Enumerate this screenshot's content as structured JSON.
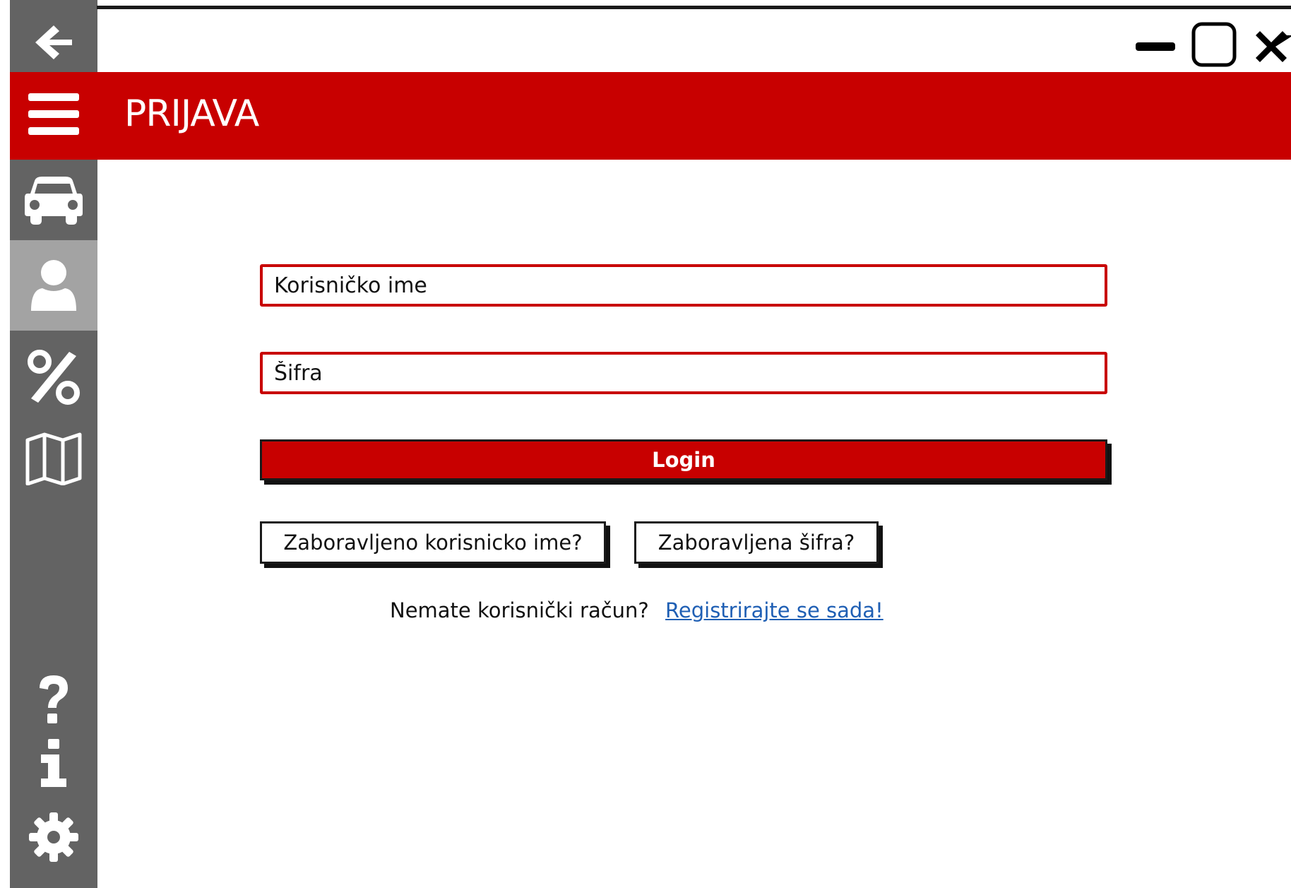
{
  "window": {
    "title": "PRIJAVA",
    "controls": [
      "minimize-icon",
      "maximize-icon",
      "close-icon"
    ]
  },
  "sidebar": {
    "items": [
      {
        "name": "back",
        "icon": "arrow-left-icon"
      },
      {
        "name": "menu",
        "icon": "hamburger-icon"
      },
      {
        "name": "vehicles",
        "icon": "car-icon"
      },
      {
        "name": "user",
        "icon": "user-icon",
        "active": true
      },
      {
        "name": "discounts",
        "icon": "percent-icon"
      },
      {
        "name": "map",
        "icon": "map-icon"
      },
      {
        "name": "help",
        "icon": "question-icon"
      },
      {
        "name": "info",
        "icon": "info-icon"
      },
      {
        "name": "settings",
        "icon": "gear-icon"
      }
    ]
  },
  "form": {
    "username_placeholder": "Korisničko ime",
    "password_placeholder": "Šifra",
    "login_label": "Login",
    "forgot_username_label": "Zaboravljeno korisnicko ime?",
    "forgot_password_label": "Zaboravljena šifra?",
    "no_account_text": "Nemate korisnički račun?",
    "register_link_text": "Registrirajte se sada!"
  },
  "colors": {
    "accent": "#c80000",
    "sidebar": "#636363",
    "sidebar_active": "#a3a3a3",
    "link": "#1f5fb4"
  }
}
